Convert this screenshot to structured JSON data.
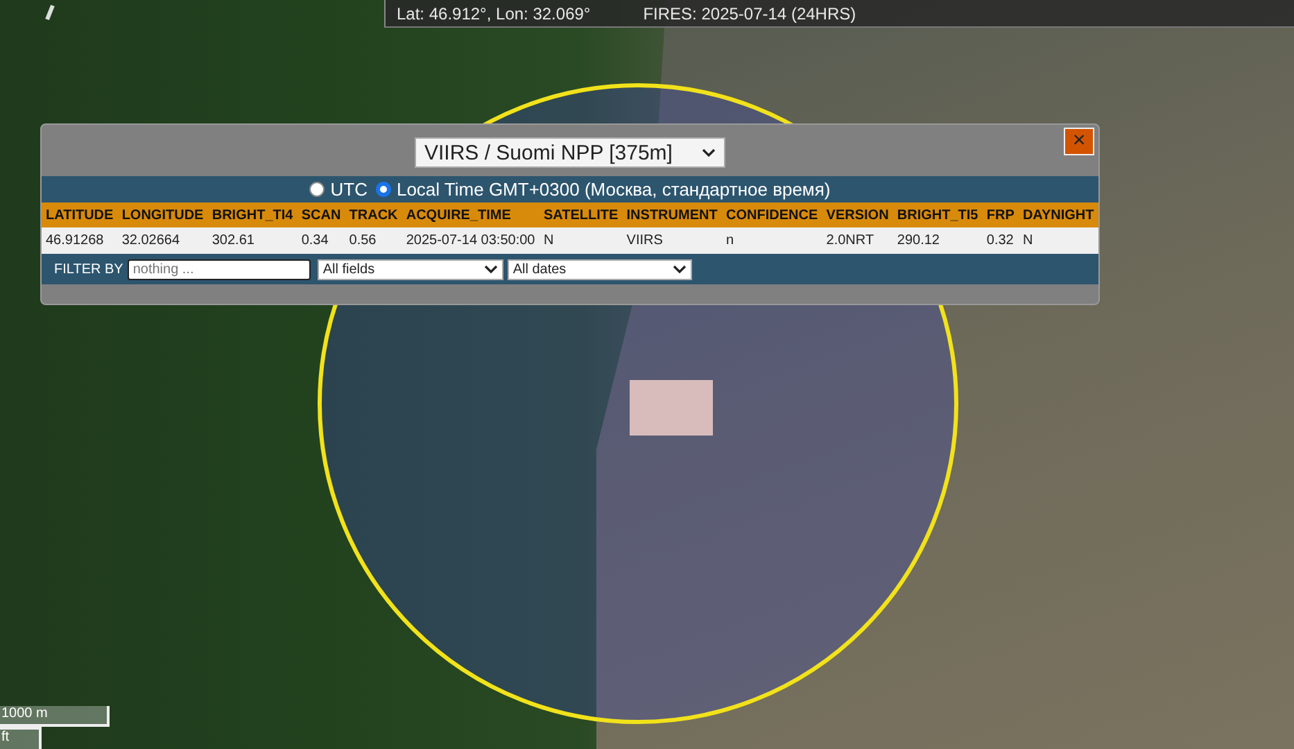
{
  "coords_bar": {
    "position": "Lat: 46.912°, Lon: 32.069°",
    "layer": "FIRES: 2025-07-14 (24HRS)"
  },
  "popup": {
    "source_select": "VIIRS / Suomi NPP [375m]",
    "close": "×",
    "time_modes": [
      {
        "label": "UTC",
        "selected": false
      },
      {
        "label": "Local Time GMT+0300 (Москва, стандартное время)",
        "selected": true
      }
    ],
    "table": {
      "columns": [
        "LATITUDE",
        "LONGITUDE",
        "BRIGHT_TI4",
        "SCAN",
        "TRACK",
        "ACQUIRE_TIME",
        "SATELLITE",
        "INSTRUMENT",
        "CONFIDENCE",
        "VERSION",
        "BRIGHT_TI5",
        "FRP",
        "DAYNIGHT"
      ],
      "rows": [
        [
          "46.91268",
          "32.02664",
          "302.61",
          "0.34",
          "0.56",
          "2025-07-14 03:50:00",
          "N",
          "VIIRS",
          "n",
          "2.0NRT",
          "290.12",
          "0.32",
          "N"
        ]
      ]
    },
    "filter": {
      "label": "FILTER BY",
      "placeholder": "nothing ...",
      "field_select": "All fields",
      "date_select": "All dates"
    }
  },
  "scale": {
    "metric": "1000 m",
    "imperial": "ft"
  }
}
